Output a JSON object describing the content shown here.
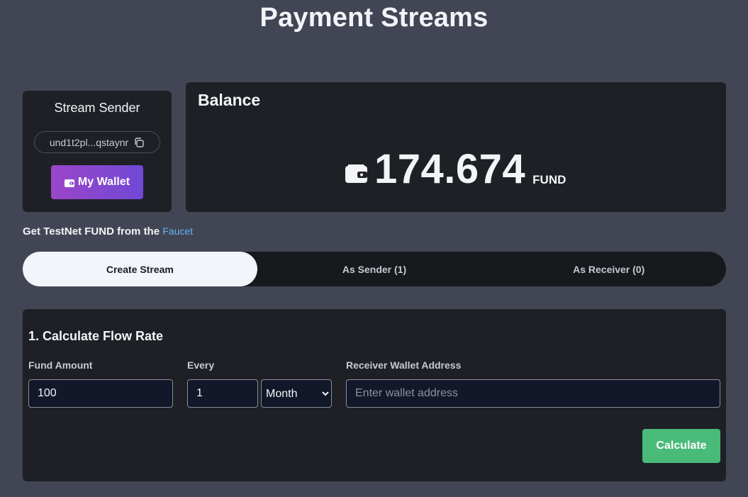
{
  "page": {
    "title": "Payment Streams"
  },
  "sender": {
    "title": "Stream Sender",
    "address": "und1t2pl...qstaynr",
    "wallet_button_label": "My Wallet"
  },
  "balance": {
    "title": "Balance",
    "amount": "174.674",
    "unit": "FUND"
  },
  "faucet": {
    "text": "Get TestNet FUND from the ",
    "link_label": "Faucet"
  },
  "tabs": [
    {
      "label": "Create Stream",
      "active": true
    },
    {
      "label": "As Sender (1)",
      "active": false
    },
    {
      "label": "As Receiver (0)",
      "active": false
    }
  ],
  "form": {
    "heading": "1. Calculate Flow Rate",
    "fund_amount_label": "Fund Amount",
    "fund_amount_value": "100",
    "every_label": "Every",
    "every_value": "1",
    "period_value": "Month",
    "receiver_label": "Receiver Wallet Address",
    "receiver_value": "",
    "receiver_placeholder": "Enter wallet address",
    "calculate_label": "Calculate"
  },
  "colors": {
    "background": "#424654",
    "card": "#1e2026",
    "wallet_button_gradient_start": "#9b46c8",
    "wallet_button_gradient_end": "#7048d6",
    "link": "#63b3ed",
    "calculate_button": "#48bb78"
  },
  "icons": {
    "copy": "copy-icon",
    "wallet": "wallet-icon"
  }
}
